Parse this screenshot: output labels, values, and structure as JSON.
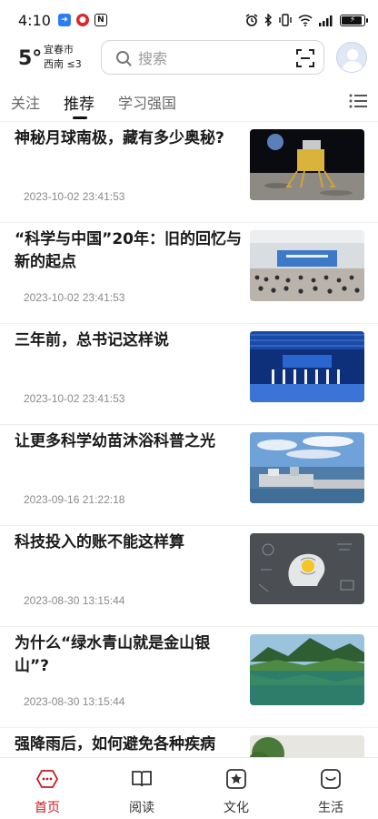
{
  "status_bar": {
    "time": "4:10",
    "app_icon_1": "blue-app-icon",
    "app_icon_2": "red-app-icon",
    "app_icon_3": "nfc-icon"
  },
  "header": {
    "temperature": "5°",
    "city": "宜春市",
    "wind": "西南 ≤3",
    "search_placeholder": "搜索"
  },
  "tabs": [
    {
      "label": "关注",
      "active": false
    },
    {
      "label": "推荐",
      "active": true
    },
    {
      "label": "学习强国",
      "active": false
    }
  ],
  "articles": [
    {
      "title": "神秘月球南极，藏有多少奥秘?",
      "time": "2023-10-02 23:41:53",
      "image": "lunar-lander-image"
    },
    {
      "title": "“科学与中国”20年：旧的回忆与新的起点",
      "time": "2023-10-02 23:41:53",
      "image": "conference-hall-image"
    },
    {
      "title": "三年前，总书记这样说",
      "time": "2023-10-02 23:41:53",
      "image": "stage-event-image"
    },
    {
      "title": "让更多科学幼苗沐浴科普之光",
      "time": "2023-09-16 21:22:18",
      "image": "coastal-facility-image"
    },
    {
      "title": "科技投入的账不能这样算",
      "time": "2023-08-30 13:15:44",
      "image": "brain-sketch-image"
    },
    {
      "title": "为什么“绿水青山就是金山银山”?",
      "time": "2023-08-30 13:15:44",
      "image": "lake-mountain-image"
    },
    {
      "title": "强降雨后，如何避免各种疾病",
      "time": "",
      "image": "tree-image"
    }
  ],
  "bottom_nav": [
    {
      "label": "首页",
      "icon": "home-icon",
      "active": true
    },
    {
      "label": "阅读",
      "icon": "book-icon",
      "active": false
    },
    {
      "label": "文化",
      "icon": "culture-icon",
      "active": false
    },
    {
      "label": "生活",
      "icon": "life-icon",
      "active": false
    }
  ],
  "colors": {
    "accent": "#c8191e",
    "text": "#1a1a1a",
    "muted": "#8a8a8a"
  }
}
